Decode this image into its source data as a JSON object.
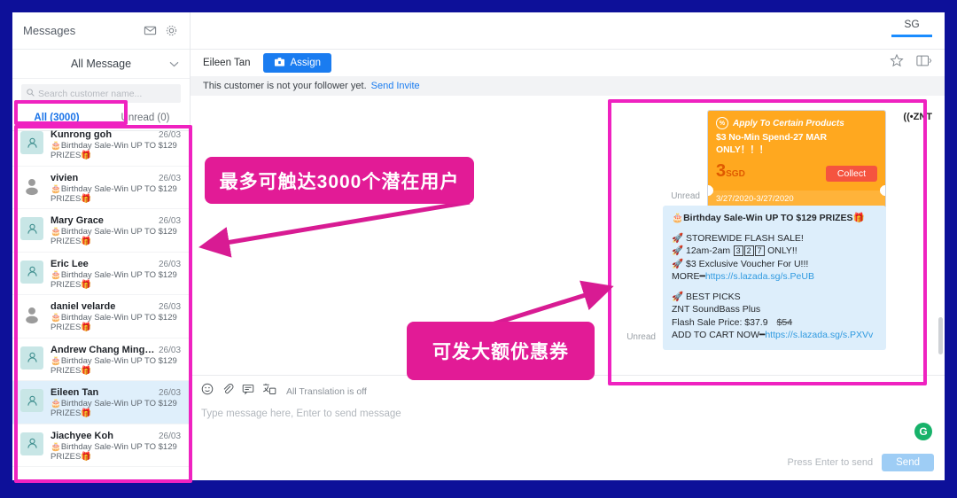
{
  "sidebar": {
    "title": "Messages",
    "icons": [
      "envelope-icon",
      "gear-icon"
    ],
    "filter_label": "All Message",
    "search_placeholder": "Search customer name...",
    "tabs": [
      {
        "label": "All (3000)",
        "active": true
      },
      {
        "label": "Unread (0)",
        "active": false
      }
    ],
    "conversations": [
      {
        "name": "Kunrong goh",
        "date": "26/03",
        "snippet": "🎂Birthday Sale-Win UP TO $129 PRIZES🎁",
        "avatar": "teal",
        "selected": false
      },
      {
        "name": "vivien",
        "date": "26/03",
        "snippet": "🎂Birthday Sale-Win UP TO $129 PRIZES🎁",
        "avatar": "grey",
        "selected": false
      },
      {
        "name": "Mary Grace",
        "date": "26/03",
        "snippet": "🎂Birthday Sale-Win UP TO $129 PRIZES🎁",
        "avatar": "teal",
        "selected": false
      },
      {
        "name": "Eric Lee",
        "date": "26/03",
        "snippet": "🎂Birthday Sale-Win UP TO $129 PRIZES🎁",
        "avatar": "teal",
        "selected": false
      },
      {
        "name": "daniel velarde",
        "date": "26/03",
        "snippet": "🎂Birthday Sale-Win UP TO $129 PRIZES🎁",
        "avatar": "grey",
        "selected": false
      },
      {
        "name": "Andrew Chang Ming K...",
        "date": "26/03",
        "snippet": "🎂Birthday Sale-Win UP TO $129 PRIZES🎁",
        "avatar": "teal",
        "selected": false
      },
      {
        "name": "Eileen Tan",
        "date": "26/03",
        "snippet": "🎂Birthday Sale-Win UP TO $129 PRIZES🎁",
        "avatar": "teal",
        "selected": true
      },
      {
        "name": "Jiachyee Koh",
        "date": "26/03",
        "snippet": "🎂Birthday Sale-Win UP TO $129 PRIZES🎁",
        "avatar": "teal",
        "selected": false
      }
    ]
  },
  "main": {
    "region_label": "SG",
    "chat_name": "Eileen Tan",
    "assign_label": "Assign",
    "notice_text": "This customer is not your follower yet.",
    "notice_link": "Send Invite",
    "header_icons": [
      "star-icon",
      "panel-toggle-icon"
    ]
  },
  "voucher": {
    "unread_label": "Unread",
    "tag_line": "Apply To Certain Products",
    "headline": "$3 No-Min Spend-27 MAR ONLY！！！",
    "amount": "3",
    "currency": "SGD",
    "collect_label": "Collect",
    "validity": "3/27/2020-3/27/2020",
    "brand": "ZNT"
  },
  "message": {
    "unread_label": "Unread",
    "title": "🎂Birthday Sale-Win UP TO $129 PRIZES🎁",
    "line1": "🚀 STOREWIDE FLASH SALE!",
    "line2_pre": "🚀 12am-2am ",
    "line2_digits": [
      "3",
      "2",
      "7"
    ],
    "line2_post": " ONLY!!",
    "line3": "🚀 $3 Exclusive Voucher For U!!!",
    "more_label": "MORE━",
    "more_link": "https://s.lazada.sg/s.PeUB",
    "bp_title": "🚀 BEST PICKS",
    "bp_product": "ZNT SoundBass Plus",
    "bp_price_label": "Flash Sale Price: $37.9",
    "bp_price_old": "$54",
    "cart_label": "ADD TO CART NOW━",
    "cart_link": "https://s.lazada.sg/s.PXVv"
  },
  "composer": {
    "translation_status": "All Translation is off",
    "placeholder": "Type message here, Enter to send message",
    "send_hint": "Press Enter to send",
    "send_label": "Send",
    "tool_icons": [
      "emoji-icon",
      "attachment-icon",
      "quick-reply-icon",
      "translate-icon"
    ],
    "grammarly_badge": "G"
  },
  "annotations": [
    {
      "id": "reach",
      "text": "最多可触达3000个潜在用户"
    },
    {
      "id": "voucher",
      "text": "可发大额优惠券"
    }
  ],
  "colors": {
    "frame": "#0d1099",
    "highlight": "#ef22c0",
    "annotation_bg": "#e21b96",
    "accent_blue": "#1a7cf0",
    "voucher_orange": "#ffa81f"
  }
}
